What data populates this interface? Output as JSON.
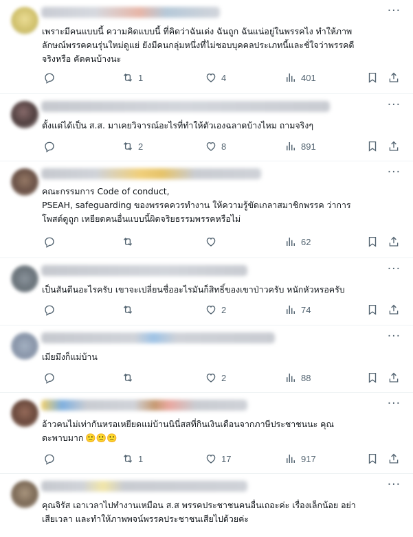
{
  "colors": {
    "text": "#0f1419",
    "muted": "#536471",
    "divider": "#eff3f4"
  },
  "icons": {
    "reply": "reply-icon",
    "retweet": "retweet-icon",
    "like": "heart-icon",
    "views": "views-icon",
    "bookmark": "bookmark-icon",
    "share": "share-icon",
    "more": "more-icon"
  },
  "replies": [
    {
      "text": "เพราะมีคนแบบนี้ ความคิดแบบนี้ ที่คิดว่าฉันเด่ง ฉันถูก ฉันแน่อยู่ในพรรคไง  ทำให้ภาพ\nลักษณ์พรรคคนรุ่นใหม่ดูแย่ ยังมีคนกลุ่มหนึ่งที่ไม่ชอบบุคคลประเภทนี้และชั่ใจว่าพรรคดี\nจริงหรือ คัดคนบ้างนะ",
      "retweets": "1",
      "likes": "4",
      "views": "401"
    },
    {
      "text": "ตั้งแต่ได้เป็น ส.ส. มาเคยวิจารณ์อะไรที่ทำให้ตัวเองฉลาดบ้างไหม ถามจริงๆ",
      "retweets": "2",
      "likes": "8",
      "views": "891"
    },
    {
      "text": "คณะกรรมการ Code of conduct,\nPSEAH, safeguarding ของพรรคควรทำงาน ให้ความรู้ขัดเกลาสมาชิกพรรค ว่าการ\nโพสต์ดูถูก เหยียดคนอื่นแบบนี้ผิดจริยธรรมพรรคหรือไม่",
      "retweets": "",
      "likes": "",
      "views": "62"
    },
    {
      "text": "เป็นสันตีนอะไรครับ เขาจะเปลี่ยนชื่ออะไรมันก็สิทธิ์ของเขาป่าวครับ หนักหัวหรอครับ",
      "retweets": "",
      "likes": "2",
      "views": "74"
    },
    {
      "text": "เมียมึงก็แม่บ้าน",
      "retweets": "",
      "likes": "2",
      "views": "88"
    },
    {
      "text": "อ้าวคนไม่เท่ากันหรอเหยียดแม่บ้านนินี่สสที่กินเงินเดือนจากภาษีประชาชนนะ  คุณ\nดะพาบมาก",
      "emoji": "🙁🙁🙁",
      "retweets": "1",
      "likes": "17",
      "views": "917"
    },
    {
      "text": "คุณจิรัส เอาเวลาไปทำงานเหมือน ส.ส พรรคประชาชนคนอื่นเถอะค่ะ เรื่องเล็กน้อย อย่า\nเสียเวลา และทำให้ภาพพจน์พรรคประชาชนเสียไปด้วยค่ะ",
      "retweets": "",
      "likes": "",
      "views": ""
    }
  ]
}
